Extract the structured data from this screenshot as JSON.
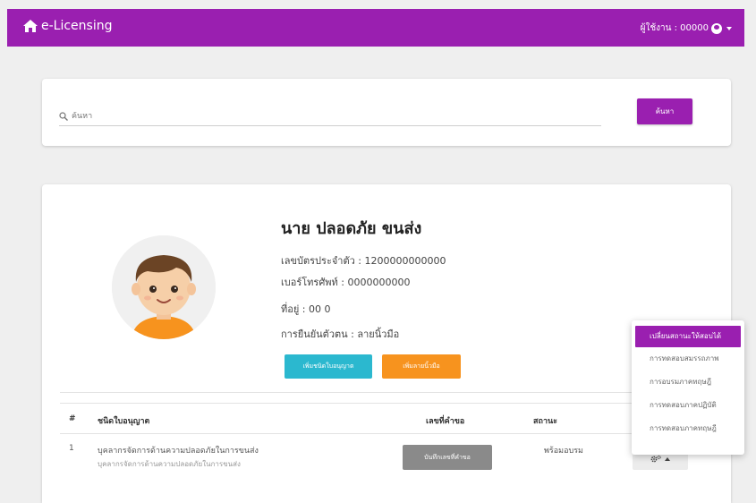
{
  "navbar": {
    "brand": "e-Licensing",
    "user_label": "ผู้ใช้งาน : 00000"
  },
  "search": {
    "placeholder": "ค้นหา",
    "button_label": "ค้นหา"
  },
  "profile": {
    "name": "นาย ปลอดภัย ขนส่ง",
    "id_card": "เลขบัตรประจำตัว : 1200000000000",
    "phone": "เบอร์โทรศัพท์ : 0000000000",
    "address": "ที่อยู่ : 00 0",
    "verification": "การยืนยันตัวตน : ลายนิ้วมือ",
    "add_license_type_label": "เพิ่มชนิดใบอนุญาต",
    "add_fingerprint_label": "เพิ่มลายนิ้วมือ"
  },
  "table": {
    "headers": [
      "#",
      "ชนิดใบอนุญาต",
      "เลขที่คำขอ",
      "สถานะ"
    ],
    "rows": [
      {
        "num": "1",
        "license_type": "บุคลากรจัดการด้านความปลอดภัยในการขนส่ง",
        "license_type_sub": "บุคลากรจัดการด้านความปลอดภัยในการขนส่ง",
        "request_button_label": "บันทึกเลขที่คำขอ",
        "status": "พร้อมอบรม"
      }
    ]
  },
  "dropdown": {
    "items": [
      {
        "label": "เปลี่ยนสถานะให้สอบได้",
        "active": true
      },
      {
        "label": "การทดสอบสมรรถภาพ",
        "active": false
      },
      {
        "label": "การอบรมภาคทฤษฎี",
        "active": false
      },
      {
        "label": "การทดสอบภาคปฏิบัติ",
        "active": false
      },
      {
        "label": "การทดสอบภาคทฤษฎี",
        "active": false
      }
    ]
  },
  "colors": {
    "primary": "#9a1fb0",
    "info": "#2bb8cf",
    "warning": "#f7931e",
    "grey_button": "#8a8a8a"
  },
  "icons": {
    "brand": "home-icon",
    "user": "user-circle-icon",
    "search": "search-icon",
    "actions": "cogs-icon"
  }
}
